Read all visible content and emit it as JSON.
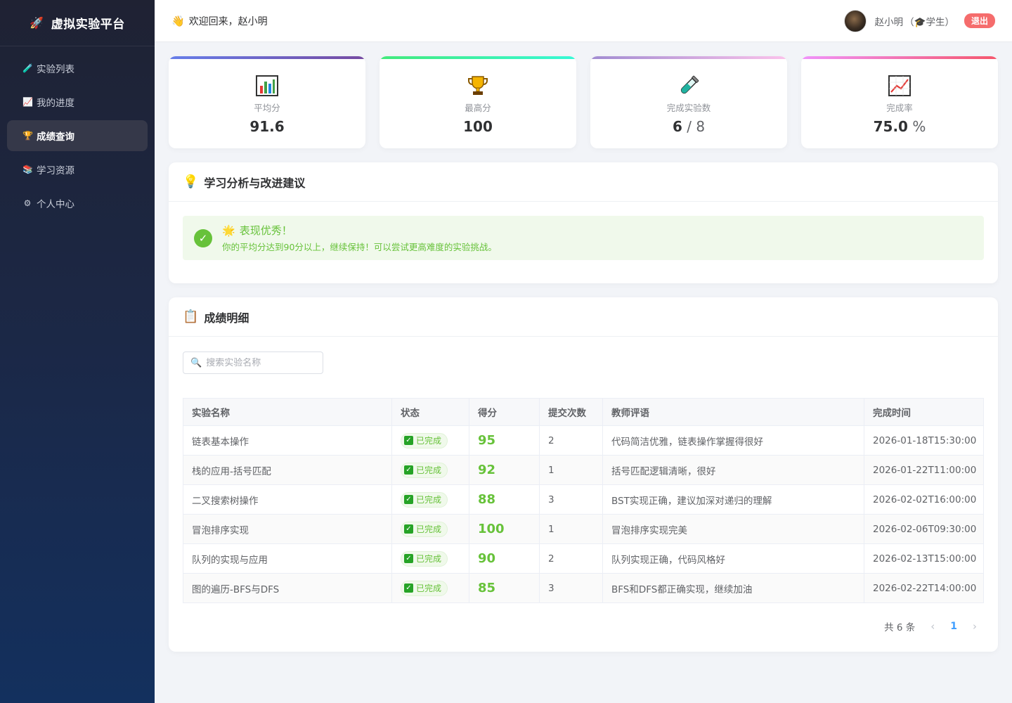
{
  "brand": {
    "title": "虚拟实验平台",
    "icon": "rocket-icon"
  },
  "sidebar": {
    "items": [
      {
        "label": "实验列表",
        "icon": "test-tube-icon",
        "glyph": "🧪",
        "active": false
      },
      {
        "label": "我的进度",
        "icon": "chart-up-icon",
        "glyph": "📈",
        "active": false
      },
      {
        "label": "成绩查询",
        "icon": "trophy-icon",
        "glyph": "🏆",
        "active": true
      },
      {
        "label": "学习资源",
        "icon": "books-icon",
        "glyph": "📚",
        "active": false
      },
      {
        "label": "个人中心",
        "icon": "gear-icon",
        "glyph": "⚙",
        "active": false
      }
    ]
  },
  "header": {
    "welcome": "欢迎回来，赵小明",
    "user_name": "赵小明",
    "role": "（🎓学生）",
    "logout": "退出"
  },
  "stats": [
    {
      "label": "平均分",
      "value": "91.6",
      "unit": "",
      "icon": "bar-chart-icon",
      "color_from": "#667eea",
      "color_to": "#764ba2"
    },
    {
      "label": "最高分",
      "value": "100",
      "unit": "",
      "icon": "trophy-icon",
      "color_from": "#43e97b",
      "color_to": "#38f9d7"
    },
    {
      "label": "完成实验数",
      "value": "6",
      "unit": " / 8",
      "icon": "test-tube-icon",
      "color_from": "#a18cd1",
      "color_to": "#fbc2eb"
    },
    {
      "label": "完成率",
      "value": "75.0",
      "unit": " %",
      "icon": "chart-up-icon",
      "color_from": "#f093fb",
      "color_to": "#f5576c"
    }
  ],
  "analysis": {
    "title": "学习分析与改进建议",
    "alert_title": "表现优秀！",
    "alert_desc": "你的平均分达到90分以上，继续保持！可以尝试更高难度的实验挑战。"
  },
  "detail": {
    "title": "成绩明细",
    "search_placeholder": "搜索实验名称",
    "columns": [
      "实验名称",
      "状态",
      "得分",
      "提交次数",
      "教师评语",
      "完成时间"
    ],
    "rows": [
      {
        "name": "链表基本操作",
        "status": "已完成",
        "score": "95",
        "submits": "2",
        "comment": "代码简洁优雅，链表操作掌握得很好",
        "time": "2026-01-18T15:30:00"
      },
      {
        "name": "栈的应用-括号匹配",
        "status": "已完成",
        "score": "92",
        "submits": "1",
        "comment": "括号匹配逻辑清晰，很好",
        "time": "2026-01-22T11:00:00"
      },
      {
        "name": "二叉搜索树操作",
        "status": "已完成",
        "score": "88",
        "submits": "3",
        "comment": "BST实现正确，建议加深对递归的理解",
        "time": "2026-02-02T16:00:00"
      },
      {
        "name": "冒泡排序实现",
        "status": "已完成",
        "score": "100",
        "submits": "1",
        "comment": "冒泡排序实现完美",
        "time": "2026-02-06T09:30:00"
      },
      {
        "name": "队列的实现与应用",
        "status": "已完成",
        "score": "90",
        "submits": "2",
        "comment": "队列实现正确，代码风格好",
        "time": "2026-02-13T15:00:00"
      },
      {
        "name": "图的遍历-BFS与DFS",
        "status": "已完成",
        "score": "85",
        "submits": "3",
        "comment": "BFS和DFS都正确实现，继续加油",
        "time": "2026-02-22T14:00:00"
      }
    ],
    "total": "共 6 条",
    "page": "1"
  }
}
